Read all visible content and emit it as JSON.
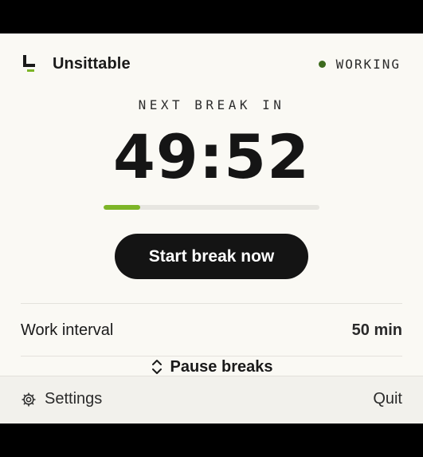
{
  "app": {
    "name": "Unsittable",
    "status": "WORKING"
  },
  "timer": {
    "label": "NEXT BREAK IN",
    "time": "49:52",
    "progress_fraction": 0.17
  },
  "actions": {
    "start_break_label": "Start break now"
  },
  "settings_rows": {
    "work_interval_label": "Work interval",
    "work_interval_value": "50 min",
    "pause_breaks_label": "Pause breaks"
  },
  "footer": {
    "settings_label": "Settings",
    "quit_label": "Quit"
  },
  "colors": {
    "background": "#FAF9F4",
    "status_dot": "#3D6B1E",
    "progress_fill": "#7DB527",
    "button": "#141414"
  },
  "icons": {
    "logo": "chair-logo-icon",
    "pause": "chevron-up-down-icon",
    "settings": "gear-icon"
  }
}
